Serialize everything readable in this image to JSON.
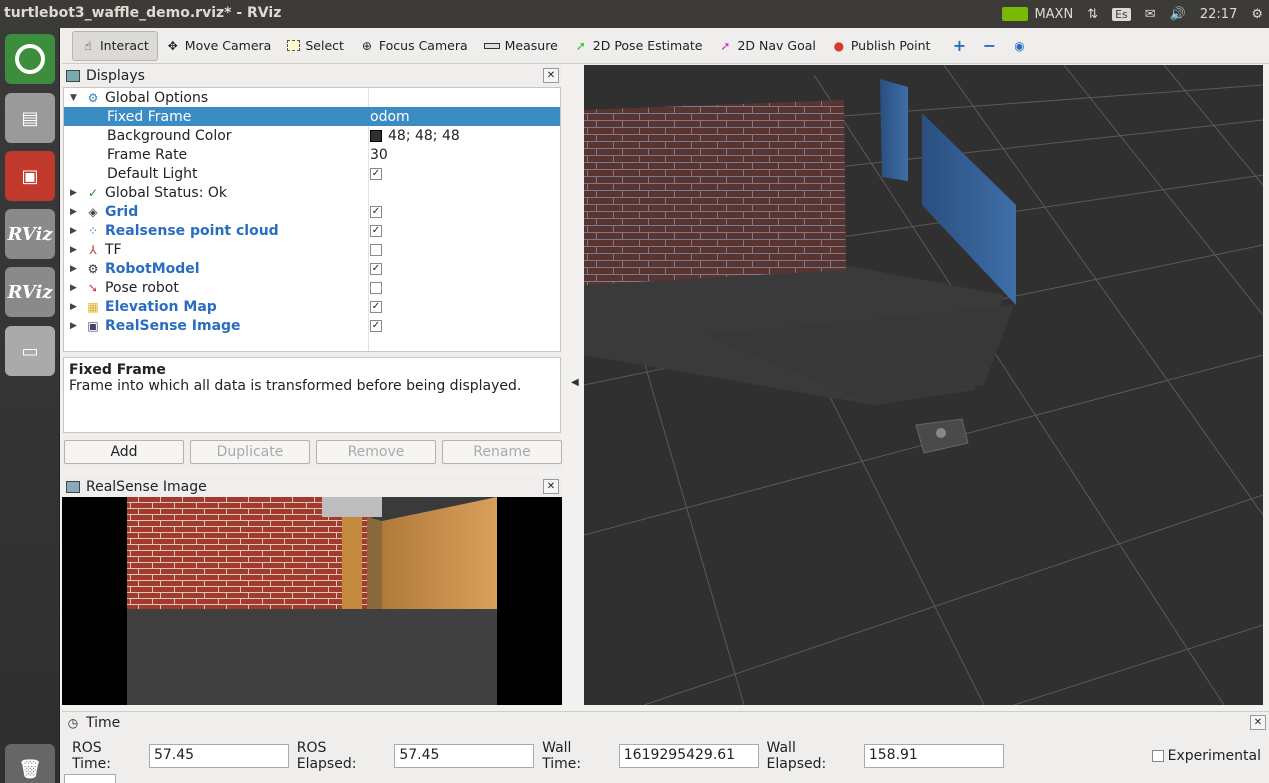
{
  "window": {
    "title": "turtlebot3_waffle_demo.rviz* - RViz"
  },
  "tray": {
    "gpu_mode": "MAXN",
    "keyboard": "Es",
    "clock": "22:17"
  },
  "launcher": {
    "rviz1": "RViz",
    "rviz2": "RViz"
  },
  "toolbar": {
    "interact": "Interact",
    "move_camera": "Move Camera",
    "select": "Select",
    "focus_camera": "Focus Camera",
    "measure": "Measure",
    "pose_estimate": "2D Pose Estimate",
    "nav_goal": "2D Nav Goal",
    "publish_point": "Publish Point"
  },
  "displays": {
    "title": "Displays",
    "global_options": "Global Options",
    "fixed_frame_label": "Fixed Frame",
    "fixed_frame_value": "odom",
    "bg_color_label": "Background Color",
    "bg_color_value": "48; 48; 48",
    "frame_rate_label": "Frame Rate",
    "frame_rate_value": "30",
    "default_light_label": "Default Light",
    "global_status": "Global Status: Ok",
    "items": [
      {
        "label": "Grid",
        "checked": true,
        "blue": true
      },
      {
        "label": "Realsense point cloud",
        "checked": true,
        "blue": true
      },
      {
        "label": "TF",
        "checked": false,
        "blue": false
      },
      {
        "label": "RobotModel",
        "checked": true,
        "blue": true
      },
      {
        "label": "Pose robot",
        "checked": false,
        "blue": false
      },
      {
        "label": "Elevation Map",
        "checked": true,
        "blue": true
      },
      {
        "label": "RealSense Image",
        "checked": true,
        "blue": true
      }
    ],
    "description_title": "Fixed Frame",
    "description_text": "Frame into which all data is transformed before being displayed.",
    "buttons": {
      "add": "Add",
      "duplicate": "Duplicate",
      "remove": "Remove",
      "rename": "Rename"
    }
  },
  "realsense": {
    "title": "RealSense Image"
  },
  "time": {
    "title": "Time",
    "ros_time_label": "ROS Time:",
    "ros_time_value": "57.45",
    "ros_elapsed_label": "ROS Elapsed:",
    "ros_elapsed_value": "57.45",
    "wall_time_label": "Wall Time:",
    "wall_time_value": "1619295429.61",
    "wall_elapsed_label": "Wall Elapsed:",
    "wall_elapsed_value": "158.91",
    "experimental_label": "Experimental"
  },
  "colors": {
    "selection": "#3b8cc4",
    "background": "#303030",
    "grid": "#5a5a5a",
    "accent_blue": "#2a6dc0"
  }
}
